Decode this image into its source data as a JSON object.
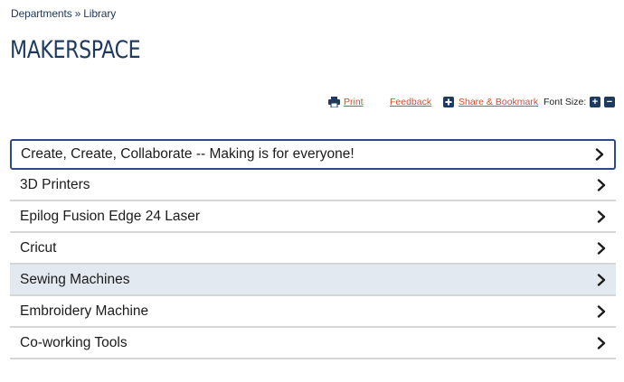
{
  "breadcrumb": {
    "items": [
      "Departments",
      "Library"
    ],
    "separator": "»"
  },
  "page": {
    "title": "MAKERSPACE"
  },
  "tools": {
    "print_label": "Print",
    "feedback_label": "Feedback",
    "share_label": "Share & Bookmark",
    "font_size_label": "Font Size:",
    "increase_symbol": "+",
    "decrease_symbol": "−"
  },
  "accordion": {
    "items": [
      {
        "label": "Create, Create, Collaborate -- Making is for everyone!",
        "state": "focused"
      },
      {
        "label": "3D Printers"
      },
      {
        "label": "Epilog Fusion Edge 24 Laser"
      },
      {
        "label": "Cricut"
      },
      {
        "label": "Sewing Machines",
        "state": "hover"
      },
      {
        "label": "Embroidery Machine"
      },
      {
        "label": "Co-working Tools"
      }
    ]
  },
  "colors": {
    "brand": "#1f3a5f",
    "link": "#cf4f2a",
    "focus_border": "#2a4b86",
    "hover_bg": "#e3e9f1"
  },
  "icons": [
    "printer-icon",
    "plus-square-icon",
    "chevron-right-icon"
  ]
}
